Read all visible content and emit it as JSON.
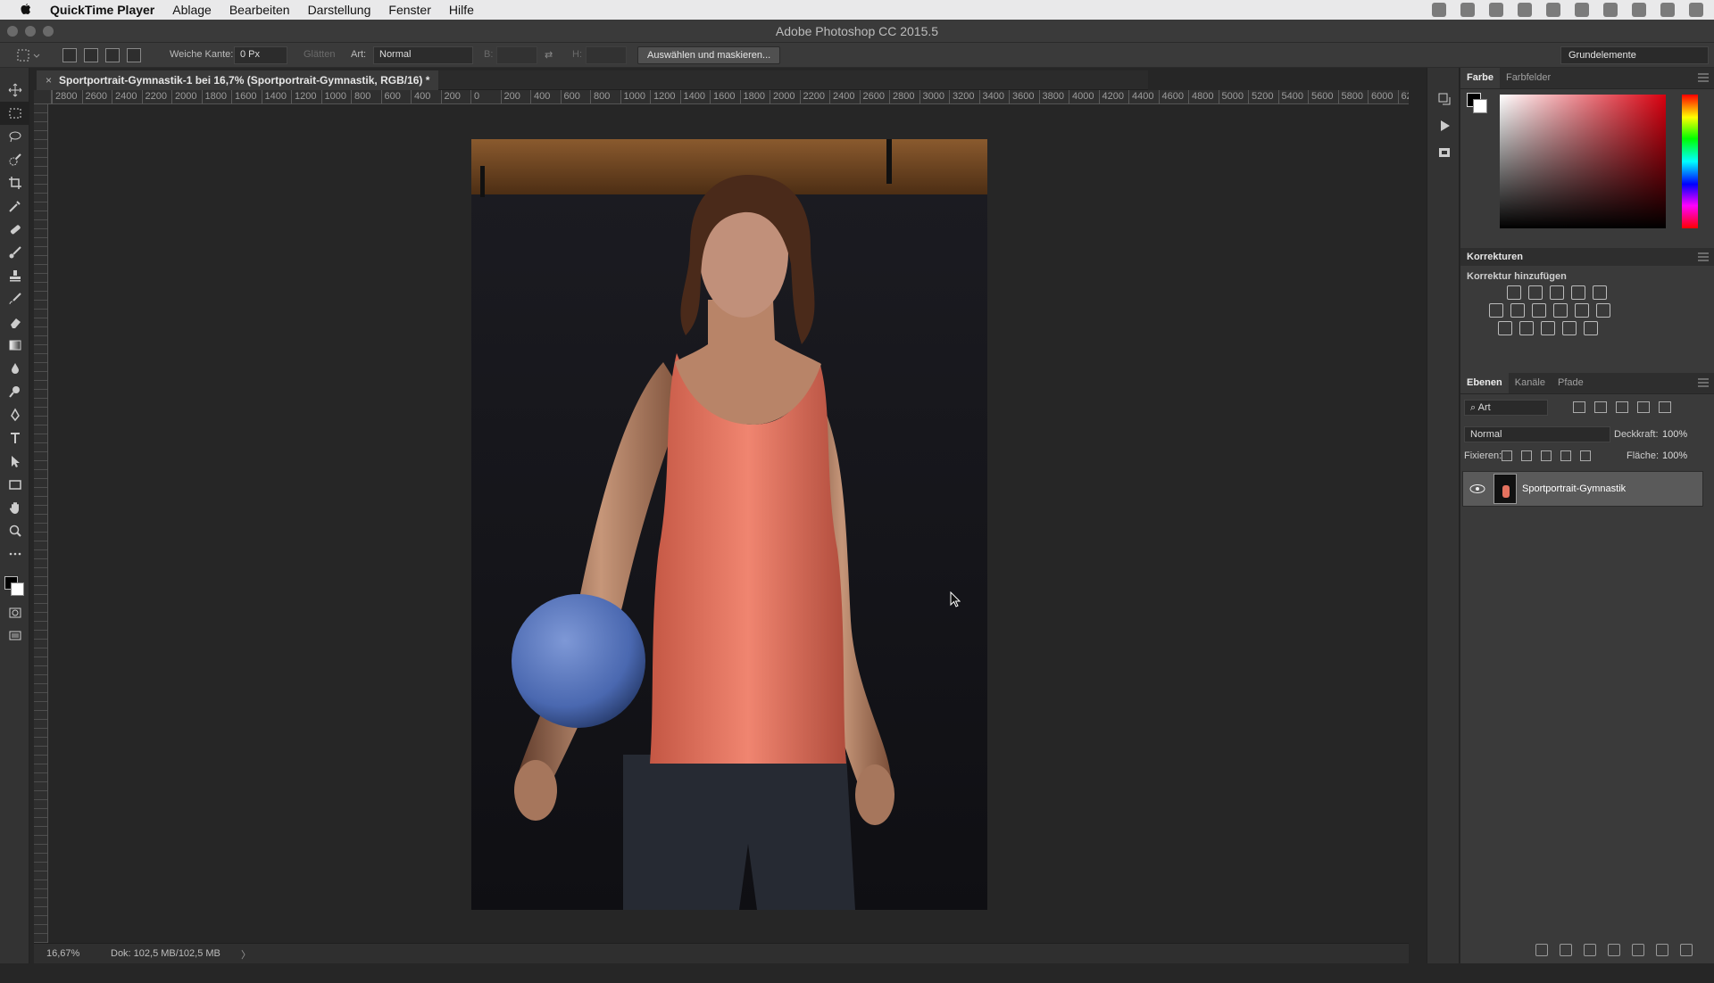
{
  "menubar": {
    "app_name": "QuickTime Player",
    "items": [
      "Ablage",
      "Bearbeiten",
      "Darstellung",
      "Fenster",
      "Hilfe"
    ]
  },
  "window": {
    "title": "Adobe Photoshop CC 2015.5"
  },
  "options": {
    "feather_label": "Weiche Kante:",
    "feather_value": "0 Px",
    "antialias_label": "Glätten",
    "style_label": "Art:",
    "style_value": "Normal",
    "width_label": "B:",
    "height_label": "H:",
    "select_mask_button": "Auswählen und maskieren...",
    "workspace": "Grundelemente"
  },
  "document": {
    "tab_title": "Sportportrait-Gymnastik-1 bei 16,7% (Sportportrait-Gymnastik, RGB/16) *",
    "close_symbol": "×",
    "ruler_labels": [
      "2800",
      "2600",
      "2400",
      "2200",
      "2000",
      "1800",
      "1600",
      "1400",
      "1200",
      "1000",
      "800",
      "600",
      "400",
      "200",
      "0",
      "200",
      "400",
      "600",
      "800",
      "1000",
      "1200",
      "1400",
      "1600",
      "1800",
      "2000",
      "2200",
      "2400",
      "2600",
      "2800",
      "3000",
      "3200",
      "3400",
      "3600",
      "3800",
      "4000",
      "4200",
      "4400",
      "4600",
      "4800",
      "5000",
      "5200",
      "5400",
      "5600",
      "5800",
      "6000",
      "62"
    ]
  },
  "status": {
    "zoom": "16,67%",
    "doc_size": "Dok: 102,5 MB/102,5 MB",
    "arrow": "〉"
  },
  "panels": {
    "color_tabs": [
      "Farbe",
      "Farbfelder"
    ],
    "adjustments_title": "Korrekturen",
    "adjustments_sub": "Korrektur hinzufügen",
    "layer_tabs": [
      "Ebenen",
      "Kanäle",
      "Pfade"
    ],
    "filter_kind": "Art",
    "blend_mode": "Normal",
    "opacity_label": "Deckkraft:",
    "opacity_value": "100%",
    "lock_label": "Fixieren:",
    "fill_label": "Fläche:",
    "fill_value": "100%",
    "layer_name": "Sportportrait-Gymnastik"
  },
  "colors": {
    "foreground": "#000000",
    "background": "#ffffff",
    "tank_top": "#e4725f",
    "ball": "#4a68b0"
  }
}
